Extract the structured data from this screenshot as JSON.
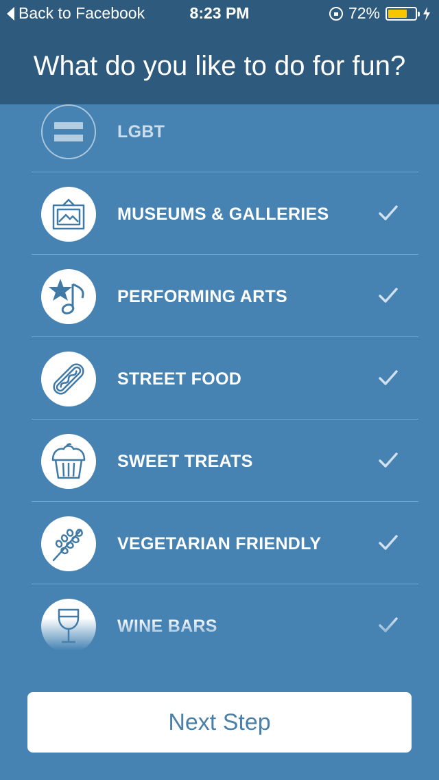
{
  "status_bar": {
    "back_label": "Back to Facebook",
    "time": "8:23 PM",
    "battery_percent": "72%",
    "battery_level": 0.72,
    "battery_color": "#f7c600"
  },
  "header": {
    "title": "What do you like to do for fun?"
  },
  "interests": [
    {
      "label": "LGBT",
      "icon": "equals-icon",
      "selected": false
    },
    {
      "label": "MUSEUMS & GALLERIES",
      "icon": "picture-frame-icon",
      "selected": true
    },
    {
      "label": "PERFORMING ARTS",
      "icon": "star-music-note-icon",
      "selected": true
    },
    {
      "label": "STREET FOOD",
      "icon": "hot-dog-icon",
      "selected": true
    },
    {
      "label": "SWEET TREATS",
      "icon": "cupcake-icon",
      "selected": true
    },
    {
      "label": "VEGETARIAN FRIENDLY",
      "icon": "wheat-icon",
      "selected": true
    },
    {
      "label": "WINE BARS",
      "icon": "wine-glass-icon",
      "selected": true
    }
  ],
  "next_button": {
    "label": "Next Step"
  },
  "colors": {
    "background": "#4683b3",
    "header": "#2e5a7d",
    "icon_stroke": "#3f79a6",
    "button_text": "#4a7fa8"
  }
}
